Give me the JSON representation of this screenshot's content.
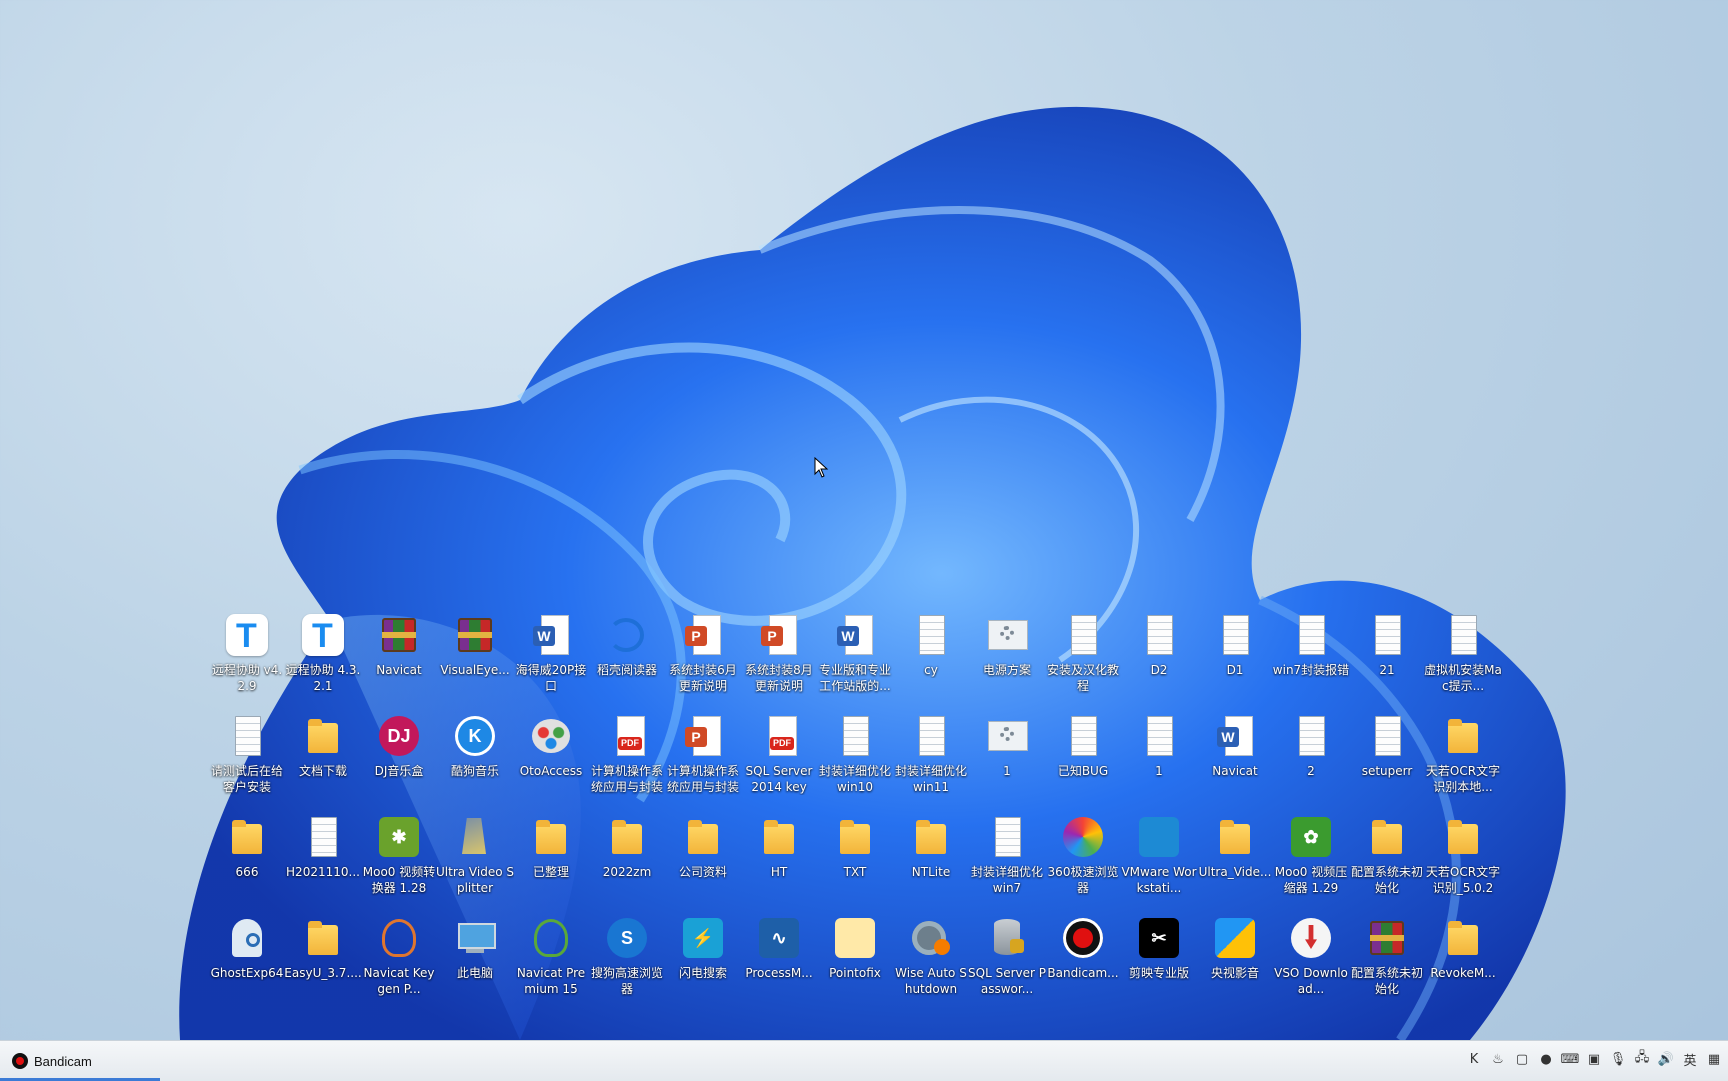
{
  "taskbar": {
    "app_label": "Bandicam",
    "tray": [
      {
        "icon": "kugou-tray-icon",
        "glyph": "K"
      },
      {
        "icon": "flame-tray-icon",
        "glyph": "♨"
      },
      {
        "icon": "window-tray-icon",
        "glyph": "▢"
      },
      {
        "icon": "record-tray-icon",
        "glyph": "●"
      },
      {
        "icon": "keyboard-tray-icon",
        "glyph": "⌨"
      },
      {
        "icon": "nvidia-tray-icon",
        "glyph": "▣"
      },
      {
        "icon": "microphone-tray-icon",
        "glyph": "🎙"
      },
      {
        "icon": "network-tray-icon",
        "glyph": "🖧"
      },
      {
        "icon": "volume-tray-icon",
        "glyph": "🔊"
      },
      {
        "icon": "ime-tray-icon",
        "glyph": "英"
      },
      {
        "icon": "grid-tray-icon",
        "glyph": "▦"
      }
    ]
  },
  "desktop": {
    "icons": [
      {
        "label": "远程协助 v4.2.9",
        "icon": "todesk-icon"
      },
      {
        "label": "远程协助 4.3.2.1",
        "icon": "todesk-icon"
      },
      {
        "label": "Navicat",
        "icon": "winrar-icon"
      },
      {
        "label": "VisualEye...",
        "icon": "winrar-icon"
      },
      {
        "label": "海得威20P接口",
        "icon": "word-icon"
      },
      {
        "label": "稻壳阅读器",
        "icon": "reader-icon"
      },
      {
        "label": "系统封装6月更新说明",
        "icon": "powerpoint-icon"
      },
      {
        "label": "系统封装8月更新说明",
        "icon": "powerpoint-icon"
      },
      {
        "label": "专业版和专业工作站版的...",
        "icon": "word-icon"
      },
      {
        "label": "cy",
        "icon": "text-file-icon"
      },
      {
        "label": "电源方案",
        "icon": "settings-file-icon"
      },
      {
        "label": "安装及汉化教程",
        "icon": "text-file-icon"
      },
      {
        "label": "D2",
        "icon": "text-file-icon"
      },
      {
        "label": "D1",
        "icon": "text-file-icon"
      },
      {
        "label": "win7封装报错",
        "icon": "text-file-icon"
      },
      {
        "label": "21",
        "icon": "text-file-icon"
      },
      {
        "label": "虚拟机安装Mac提示...",
        "icon": "text-file-icon"
      },
      {
        "label": "请测试后在给客户安装",
        "icon": "text-file-icon"
      },
      {
        "label": "文档下载",
        "icon": "folder-icon"
      },
      {
        "label": "DJ音乐盒",
        "icon": "dj-music-icon"
      },
      {
        "label": "酷狗音乐",
        "icon": "kugou-icon"
      },
      {
        "label": "OtoAccess",
        "icon": "otoaccess-icon"
      },
      {
        "label": "计算机操作系统应用与封装",
        "icon": "pdf-icon"
      },
      {
        "label": "计算机操作系统应用与封装",
        "icon": "powerpoint-icon"
      },
      {
        "label": "SQL Server 2014 key",
        "icon": "pdf-icon"
      },
      {
        "label": "封装详细优化win10",
        "icon": "text-file-icon"
      },
      {
        "label": "封装详细优化win11",
        "icon": "text-file-icon"
      },
      {
        "label": "1",
        "icon": "settings-file-icon"
      },
      {
        "label": "已知BUG",
        "icon": "text-file-icon"
      },
      {
        "label": "1",
        "icon": "text-file-icon"
      },
      {
        "label": "Navicat",
        "icon": "word-icon"
      },
      {
        "label": "2",
        "icon": "text-file-icon"
      },
      {
        "label": "setuperr",
        "icon": "text-file-icon"
      },
      {
        "label": "天若OCR文字识别本地...",
        "icon": "folder-icon"
      },
      {
        "label": "666",
        "icon": "folder-icon"
      },
      {
        "label": "H2021110...",
        "icon": "text-file-icon"
      },
      {
        "label": "Moo0 视频转换器 1.28",
        "icon": "moo0-converter-icon"
      },
      {
        "label": "Ultra Video Splitter",
        "icon": "ultra-video-splitter-icon"
      },
      {
        "label": "已整理",
        "icon": "folder-icon"
      },
      {
        "label": "2022zm",
        "icon": "folder-icon"
      },
      {
        "label": "公司资料",
        "icon": "folder-icon"
      },
      {
        "label": "HT",
        "icon": "folder-icon"
      },
      {
        "label": "TXT",
        "icon": "folder-icon"
      },
      {
        "label": "NTLite",
        "icon": "folder-icon"
      },
      {
        "label": "封装详细优化win7",
        "icon": "text-file-icon"
      },
      {
        "label": "360极速浏览器",
        "icon": "browser-360-icon"
      },
      {
        "label": "VMware Workstati...",
        "icon": "vmware-icon"
      },
      {
        "label": "Ultra_Vide...",
        "icon": "folder-icon"
      },
      {
        "label": "Moo0 视频压缩器 1.29",
        "icon": "moo0-compressor-icon"
      },
      {
        "label": "配置系统未初始化",
        "icon": "folder-icon"
      },
      {
        "label": "天若OCR文字识别_5.0.2",
        "icon": "folder-icon"
      },
      {
        "label": "GhostExp64",
        "icon": "ghost-explorer-icon"
      },
      {
        "label": "EasyU_3.7....",
        "icon": "folder-icon"
      },
      {
        "label": "Navicat Keygen P...",
        "icon": "navicat-keygen-icon"
      },
      {
        "label": "此电脑",
        "icon": "this-pc-icon"
      },
      {
        "label": "Navicat Premium 15",
        "icon": "navicat-premium-icon"
      },
      {
        "label": "搜狗高速浏览器",
        "icon": "sogou-browser-icon"
      },
      {
        "label": "闪电搜索",
        "icon": "flash-search-icon"
      },
      {
        "label": "ProcessM...",
        "icon": "process-monitor-icon"
      },
      {
        "label": "Pointofix",
        "icon": "pointofix-icon"
      },
      {
        "label": "Wise Auto Shutdown",
        "icon": "wise-shutdown-icon"
      },
      {
        "label": "SQL Server Passwor...",
        "icon": "sql-server-icon"
      },
      {
        "label": "Bandicam...",
        "icon": "bandicam-icon"
      },
      {
        "label": "剪映专业版",
        "icon": "jianying-icon"
      },
      {
        "label": "央视影音",
        "icon": "cctv-video-icon"
      },
      {
        "label": "VSO Download...",
        "icon": "vso-downloader-icon"
      },
      {
        "label": "配置系统未初始化",
        "icon": "winrar-icon"
      },
      {
        "label": "RevokeM...",
        "icon": "folder-icon"
      }
    ]
  }
}
